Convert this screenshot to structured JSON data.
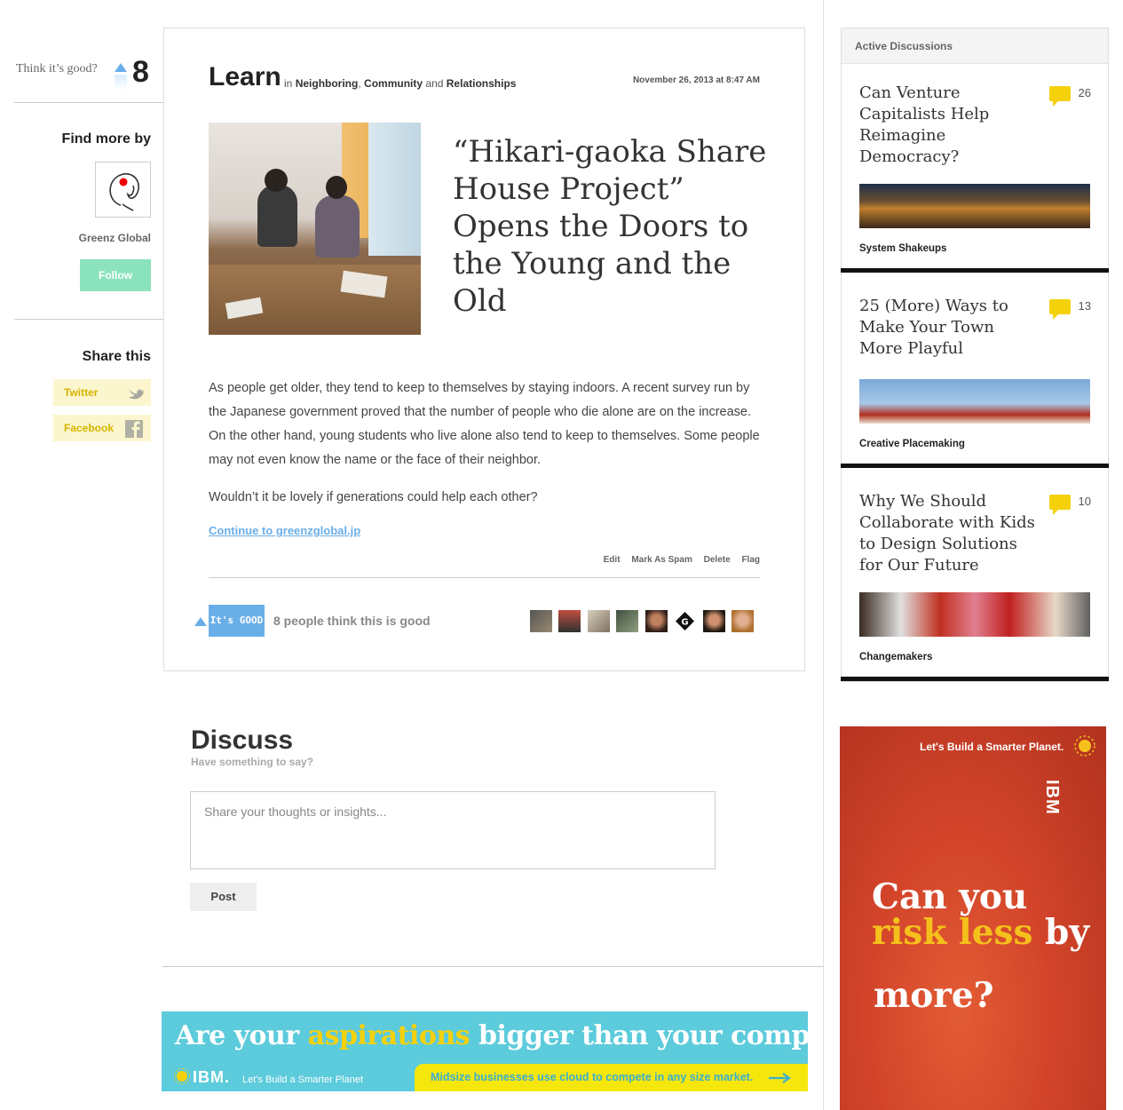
{
  "left": {
    "think_label": "Think it’s good?",
    "vote_count": "8",
    "find_more_heading": "Find more by",
    "author_name": "Greenz Global",
    "follow_label": "Follow",
    "share_heading": "Share this",
    "share_buttons": [
      "Twitter",
      "Facebook"
    ]
  },
  "article": {
    "section": "Learn",
    "crumb_in": "in",
    "categories": [
      "Neighboring",
      "Community",
      "Relationships"
    ],
    "crumb_sep": ",",
    "crumb_and": "and",
    "date": "November 26, 2013 at 8:47 AM",
    "title": "“Hikari-gaoka Share House Project” Opens the Doors to the Young and the Old",
    "paragraphs": [
      "As people get older, they tend to keep to themselves by staying indoors. A recent survey run by the Japanese government proved that the number of people who die alone are on the increase. On the other hand, young students who live alone also tend to keep to themselves. Some people may not even know the name or the face of their neighbor.",
      "Wouldn’t it be lovely if generations could help each other?"
    ],
    "continue_link": "Continue to greenzglobal.jp",
    "actions": [
      "Edit",
      "Mark As Spam",
      "Delete",
      "Flag"
    ],
    "its_good_label": "It's GOOD",
    "people_text": "8 people think this is good"
  },
  "discuss": {
    "heading": "Discuss",
    "subheading": "Have something to say?",
    "placeholder": "Share your thoughts or insights...",
    "post_label": "Post"
  },
  "banner_ad": {
    "head_before": "Are your",
    "head_highlight": "aspirations",
    "head_after": "bigger than your company?",
    "logo": "IBM.",
    "tagline": "Let's Build a Smarter Planet",
    "cta": "Midsize businesses use cloud to compete in any size market."
  },
  "sidebar": {
    "heading": "Active Discussions",
    "items": [
      {
        "title": "Can Venture Capitalists Help Reimagine Democracy?",
        "count": "26",
        "category": "System Shakeups"
      },
      {
        "title": "25 (More) Ways to Make Your Town More Playful",
        "count": "13",
        "category": "Creative Placemaking"
      },
      {
        "title": "Why We Should Collaborate with Kids to Design Solutions for Our Future",
        "count": "10",
        "category": "Changemakers"
      }
    ]
  },
  "side_ad": {
    "tagline": "Let's Build a Smarter Planet.",
    "logo": "IBM",
    "line1": "Can you",
    "line2_highlight": "risk less",
    "line2_after": "by",
    "line3": "more?"
  },
  "colors": {
    "accent_blue": "#6aaee8",
    "follow_green": "#8be3bd",
    "share_yellow": "#fbf6cd",
    "comment_yellow": "#f5d10b",
    "banner_cyan": "#5ccbdb",
    "ad_red": "#d2442a"
  }
}
